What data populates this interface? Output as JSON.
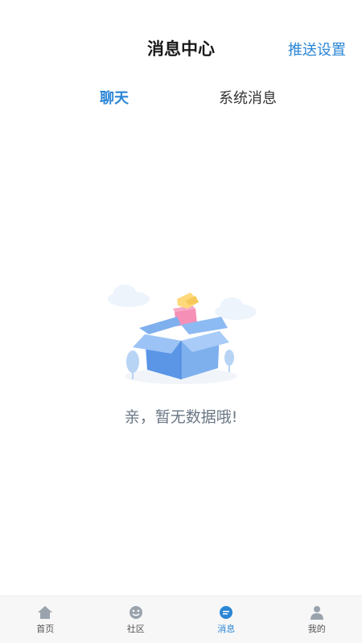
{
  "header": {
    "title": "消息中心",
    "push_settings_label": "推送设置"
  },
  "tabs": [
    {
      "label": "聊天",
      "active": true
    },
    {
      "label": "系统消息",
      "active": false
    }
  ],
  "empty_state": {
    "message": "亲，暂无数据哦!",
    "illustration": "open-box-illustration"
  },
  "tabbar": {
    "items": [
      {
        "label": "首页",
        "icon": "home-icon",
        "active": false
      },
      {
        "label": "社区",
        "icon": "community-icon",
        "active": false
      },
      {
        "label": "消息",
        "icon": "message-icon",
        "active": true
      },
      {
        "label": "我的",
        "icon": "profile-icon",
        "active": false
      }
    ]
  },
  "colors": {
    "accent": "#2b86d6",
    "text_primary": "#1a1a1a",
    "text_muted": "#6a7785",
    "tabbar_bg": "#f7f7f7"
  }
}
